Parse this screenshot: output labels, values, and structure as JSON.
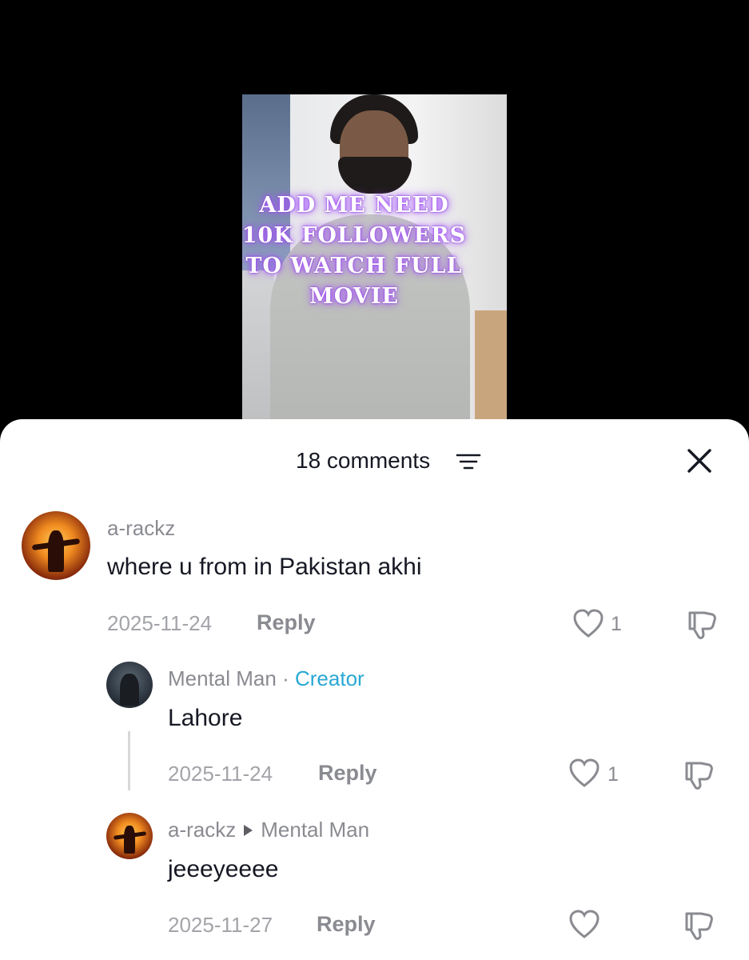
{
  "video": {
    "caption": [
      "ADD ME NEED",
      "10K FOLLOWERS",
      "TO WATCH FULL",
      "MOVIE"
    ]
  },
  "comments_panel": {
    "count_label": "18 comments",
    "icons": {
      "filter": "filter-lines-icon",
      "close": "close-x-icon"
    }
  },
  "comments": [
    {
      "username": "a-rackz",
      "text": "where u from in Pakistan akhi",
      "date": "2025-11-24",
      "reply_label": "Reply",
      "likes": "1"
    },
    {
      "username": "Mental Man",
      "separator": "·",
      "badge": "Creator",
      "text": "Lahore",
      "date": "2025-11-24",
      "reply_label": "Reply",
      "likes": "1"
    },
    {
      "username": "a-rackz",
      "reply_to": "Mental Man",
      "text": "jeeeyeeee",
      "date": "2025-11-27",
      "reply_label": "Reply"
    }
  ],
  "colors": {
    "creator": "#2aa8d4",
    "muted": "#8a8b91",
    "text": "#161823"
  }
}
